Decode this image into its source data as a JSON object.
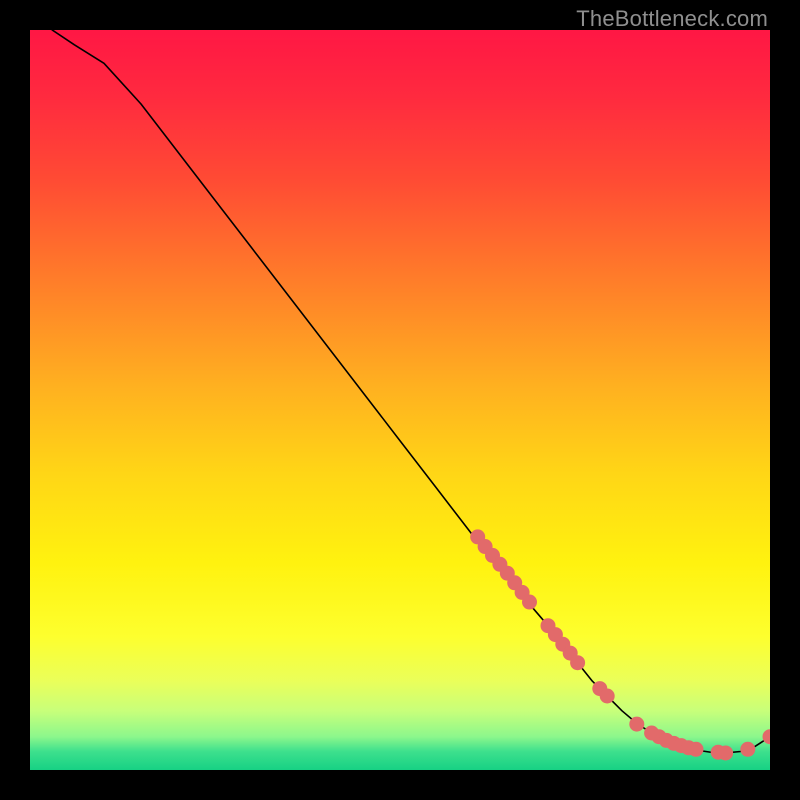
{
  "watermark": "TheBottleneck.com",
  "chart_data": {
    "type": "line",
    "title": "",
    "xlabel": "",
    "ylabel": "",
    "xlim": [
      0,
      100
    ],
    "ylim": [
      0,
      100
    ],
    "gradient_stops": [
      {
        "offset": 0.0,
        "color": "#ff1744"
      },
      {
        "offset": 0.09,
        "color": "#ff2a3f"
      },
      {
        "offset": 0.2,
        "color": "#ff4a34"
      },
      {
        "offset": 0.33,
        "color": "#ff7a2a"
      },
      {
        "offset": 0.48,
        "color": "#ffb020"
      },
      {
        "offset": 0.6,
        "color": "#ffd616"
      },
      {
        "offset": 0.72,
        "color": "#fff20f"
      },
      {
        "offset": 0.82,
        "color": "#fdff2e"
      },
      {
        "offset": 0.88,
        "color": "#eaff5a"
      },
      {
        "offset": 0.92,
        "color": "#c8ff7a"
      },
      {
        "offset": 0.955,
        "color": "#8cf78c"
      },
      {
        "offset": 0.975,
        "color": "#3de08d"
      },
      {
        "offset": 1.0,
        "color": "#17d184"
      }
    ],
    "line": {
      "x": [
        3,
        6,
        10,
        15,
        20,
        25,
        30,
        35,
        40,
        45,
        50,
        55,
        60,
        62,
        65,
        67,
        70,
        72,
        74,
        76,
        78,
        80,
        82,
        84,
        86,
        88,
        90,
        92,
        94,
        96,
        98,
        100
      ],
      "y": [
        100,
        98,
        95.5,
        90,
        83.5,
        77,
        70.5,
        64,
        57.5,
        51,
        44.5,
        38,
        31.5,
        29,
        25.5,
        23,
        19.5,
        17,
        14.5,
        12,
        10,
        8,
        6.3,
        5,
        4,
        3.2,
        2.7,
        2.4,
        2.3,
        2.5,
        3.2,
        4.5
      ]
    },
    "markers": {
      "color": "#e26a6a",
      "radius": 7.5,
      "points": [
        {
          "x": 60.5,
          "y": 31.5
        },
        {
          "x": 61.5,
          "y": 30.2
        },
        {
          "x": 62.5,
          "y": 29.0
        },
        {
          "x": 63.5,
          "y": 27.8
        },
        {
          "x": 64.5,
          "y": 26.6
        },
        {
          "x": 65.5,
          "y": 25.3
        },
        {
          "x": 66.5,
          "y": 24.0
        },
        {
          "x": 67.5,
          "y": 22.7
        },
        {
          "x": 70.0,
          "y": 19.5
        },
        {
          "x": 71.0,
          "y": 18.3
        },
        {
          "x": 72.0,
          "y": 17.0
        },
        {
          "x": 73.0,
          "y": 15.8
        },
        {
          "x": 74.0,
          "y": 14.5
        },
        {
          "x": 77.0,
          "y": 11.0
        },
        {
          "x": 78.0,
          "y": 10.0
        },
        {
          "x": 82.0,
          "y": 6.2
        },
        {
          "x": 84.0,
          "y": 5.0
        },
        {
          "x": 85.0,
          "y": 4.5
        },
        {
          "x": 86.0,
          "y": 4.0
        },
        {
          "x": 87.0,
          "y": 3.6
        },
        {
          "x": 88.0,
          "y": 3.3
        },
        {
          "x": 89.0,
          "y": 3.0
        },
        {
          "x": 90.0,
          "y": 2.8
        },
        {
          "x": 93.0,
          "y": 2.4
        },
        {
          "x": 94.0,
          "y": 2.3
        },
        {
          "x": 97.0,
          "y": 2.8
        },
        {
          "x": 100.0,
          "y": 4.5
        }
      ]
    }
  }
}
